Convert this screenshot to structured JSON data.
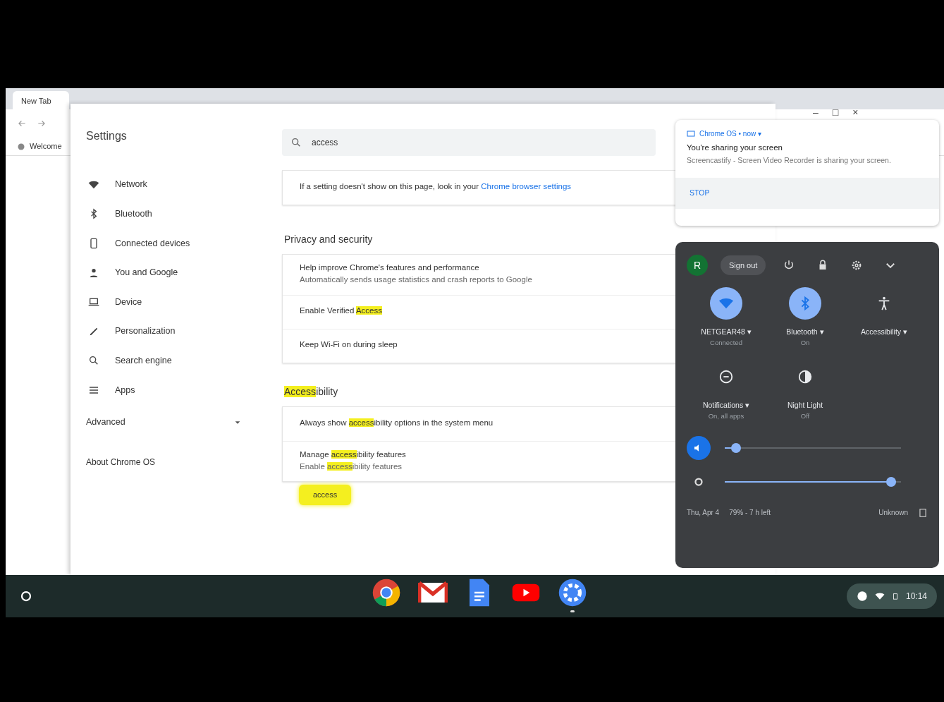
{
  "browser": {
    "tab": "New Tab",
    "bookmark": "Welcome"
  },
  "settings": {
    "title": "Settings",
    "search": {
      "value": "access"
    },
    "nav": [
      {
        "label": "Network"
      },
      {
        "label": "Bluetooth"
      },
      {
        "label": "Connected devices"
      },
      {
        "label": "You and Google"
      },
      {
        "label": "Device"
      },
      {
        "label": "Personalization"
      },
      {
        "label": "Search engine"
      },
      {
        "label": "Apps"
      }
    ],
    "advanced": {
      "label": "Advanced",
      "expanded": false
    },
    "about": "About Chrome OS",
    "info": {
      "text": "If a setting doesn't show on this page, look in your ",
      "link": "Chrome browser settings"
    },
    "sections": [
      {
        "heading": [
          {
            "text": "Privacy and security",
            "highlight": false
          }
        ],
        "rows": [
          {
            "title": [
              {
                "text": "Help improve Chrome's features and performance",
                "highlight": false
              }
            ],
            "subtitle": [
              {
                "text": "Automatically sends usage statistics and crash reports to Google",
                "highlight": false
              }
            ]
          },
          {
            "title": [
              {
                "text": "Enable Verified ",
                "highlight": false
              },
              {
                "text": "Access",
                "highlight": true
              }
            ]
          },
          {
            "title": [
              {
                "text": "Keep Wi-Fi on during sleep",
                "highlight": false
              }
            ]
          }
        ]
      },
      {
        "heading": [
          {
            "text": "Access",
            "highlight": true
          },
          {
            "text": "ibility",
            "highlight": false
          }
        ],
        "rows": [
          {
            "title": [
              {
                "text": "Always show ",
                "highlight": false
              },
              {
                "text": "access",
                "highlight": true
              },
              {
                "text": "ibility options in the system menu",
                "highlight": false
              }
            ]
          },
          {
            "title": [
              {
                "text": "Manage ",
                "highlight": false
              },
              {
                "text": "access",
                "highlight": true
              },
              {
                "text": "ibility features",
                "highlight": false
              }
            ],
            "subtitle": [
              {
                "text": "Enable ",
                "highlight": false
              },
              {
                "text": "access",
                "highlight": true
              },
              {
                "text": "ibility features",
                "highlight": false
              }
            ]
          }
        ]
      }
    ],
    "search_bubble": "access",
    "window_controls": [
      "–",
      "□",
      "×"
    ]
  },
  "notification": {
    "source": "Chrome OS • now ▾",
    "title": "You're sharing your screen",
    "body": "Screencastify - Screen Video Recorder is sharing your screen.",
    "action": "STOP"
  },
  "tray": {
    "avatar": "R",
    "sign_out": "Sign out",
    "tiles": [
      {
        "label": "NETGEAR48 ▾",
        "sublabel": "Connected",
        "on": true
      },
      {
        "label": "Bluetooth ▾",
        "sublabel": "On",
        "on": true
      },
      {
        "label": "Accessibility ▾",
        "on": false
      },
      {
        "label": "Notifications ▾",
        "sublabel": "On, all apps",
        "on": false
      },
      {
        "label": "Night Light",
        "sublabel": "Off",
        "on": false
      }
    ],
    "sliders": [
      {
        "kind": "volume",
        "level": 0.04
      },
      {
        "kind": "brightness",
        "level": 0.97
      }
    ],
    "date": "Thu, Apr 4",
    "battery": "79% - 7 h left",
    "managed": "Unknown"
  },
  "shelf": {
    "apps": [
      {
        "kind": "chrome",
        "active": false
      },
      {
        "kind": "gmail",
        "active": false
      },
      {
        "kind": "docs",
        "active": false
      },
      {
        "kind": "youtube",
        "active": false
      },
      {
        "kind": "settings",
        "active": true
      }
    ],
    "time": "10:14"
  }
}
